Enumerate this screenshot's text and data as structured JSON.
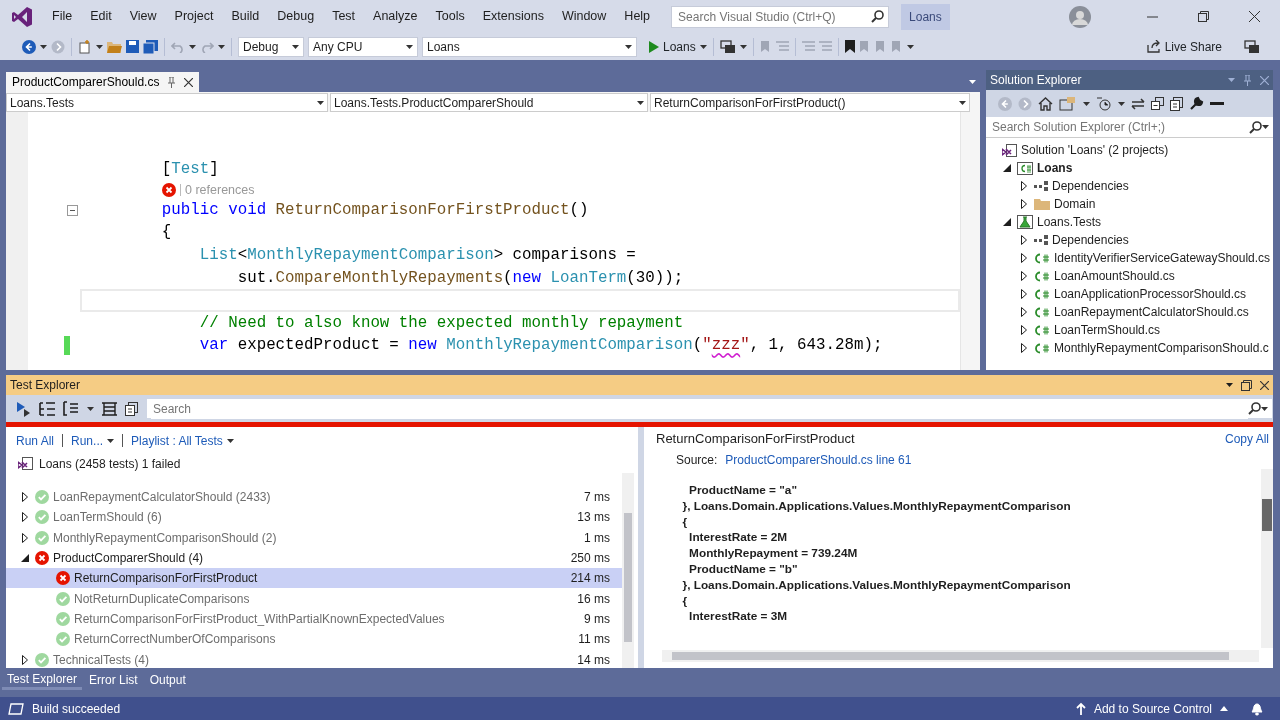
{
  "menu": [
    "File",
    "Edit",
    "View",
    "Project",
    "Build",
    "Debug",
    "Test",
    "Analyze",
    "Tools",
    "Extensions",
    "Window",
    "Help"
  ],
  "search": {
    "placeholder": "Search Visual Studio (Ctrl+Q)"
  },
  "solution_name": "Loans",
  "toolbar": {
    "configuration": "Debug",
    "platform": "Any CPU",
    "startup_project": "Loans",
    "run": "Loans",
    "live_share": "Live Share"
  },
  "editor": {
    "tab": "ProductComparerShould.cs",
    "navigation": [
      "Loans.Tests",
      "Loans.Tests.ProductComparerShould",
      "ReturnComparisonForFirstProduct()"
    ],
    "lines": [
      {
        "kind": "blank"
      },
      {
        "kind": "blank"
      },
      {
        "kind": "code",
        "tokens": [
          {
            "text": "        [",
            "kind": "plain"
          },
          {
            "text": "Test",
            "kind": "type"
          },
          {
            "text": "]",
            "kind": "plain"
          }
        ]
      },
      {
        "kind": "codelens",
        "failed": true,
        "text": "0 references"
      },
      {
        "kind": "code",
        "collapsible": true,
        "tokens": [
          {
            "text": "        public void ",
            "kind": "keyword"
          },
          {
            "text": "ReturnComparisonForFirstProduct",
            "kind": "method"
          },
          {
            "text": "()",
            "kind": "plain"
          }
        ]
      },
      {
        "kind": "code",
        "tokens": [
          {
            "text": "        {",
            "kind": "plain"
          }
        ]
      },
      {
        "kind": "code",
        "tokens": [
          {
            "text": "            List",
            "kind": "type"
          },
          {
            "text": "<",
            "kind": "plain"
          },
          {
            "text": "MonthlyRepaymentComparison",
            "kind": "type"
          },
          {
            "text": "> comparisons =",
            "kind": "plain"
          }
        ]
      },
      {
        "kind": "code",
        "tokens": [
          {
            "text": "                sut.",
            "kind": "plain"
          },
          {
            "text": "CompareMonthlyRepayments",
            "kind": "method"
          },
          {
            "text": "(",
            "kind": "plain"
          },
          {
            "text": "new ",
            "kind": "keyword"
          },
          {
            "text": "LoanTerm",
            "kind": "type"
          },
          {
            "text": "(30));",
            "kind": "plain"
          }
        ]
      },
      {
        "kind": "blank",
        "current": true
      },
      {
        "kind": "code",
        "tokens": [
          {
            "text": "            // Need to also know the expected monthly repayment",
            "kind": "comment"
          }
        ]
      },
      {
        "kind": "code",
        "changed": true,
        "tokens": [
          {
            "text": "            var ",
            "kind": "keyword"
          },
          {
            "text": "expectedProduct = ",
            "kind": "plain"
          },
          {
            "text": "new ",
            "kind": "keyword"
          },
          {
            "text": "MonthlyRepaymentComparison",
            "kind": "type"
          },
          {
            "text": "(",
            "kind": "plain"
          },
          {
            "text": "\"",
            "kind": "string"
          },
          {
            "text": "zzz",
            "kind": "string",
            "squiggle": true
          },
          {
            "text": "\"",
            "kind": "string"
          },
          {
            "text": ", 1, 643.28m);",
            "kind": "plain"
          }
        ]
      }
    ]
  },
  "solution_explorer": {
    "title": "Solution Explorer",
    "search": {
      "placeholder": "Search Solution Explorer (Ctrl+;)"
    },
    "tree": [
      {
        "label": "Solution 'Loans' (2 projects)",
        "kind": "solution",
        "children": [
          {
            "label": "Loans",
            "kind": "project",
            "expanded": true,
            "children": [
              {
                "label": "Dependencies",
                "kind": "dependencies",
                "expanded": false
              },
              {
                "label": "Domain",
                "kind": "folder",
                "expanded": false
              }
            ]
          },
          {
            "label": "Loans.Tests",
            "kind": "test-project",
            "expanded": true,
            "children": [
              {
                "label": "Dependencies",
                "kind": "dependencies",
                "expanded": false
              },
              {
                "label": "IdentityVerifierServiceGatewayShould.cs",
                "kind": "csharp",
                "expanded": false
              },
              {
                "label": "LoanAmountShould.cs",
                "kind": "csharp",
                "expanded": false
              },
              {
                "label": "LoanApplicationProcessorShould.cs",
                "kind": "csharp",
                "expanded": false
              },
              {
                "label": "LoanRepaymentCalculatorShould.cs",
                "kind": "csharp",
                "expanded": false
              },
              {
                "label": "LoanTermShould.cs",
                "kind": "csharp",
                "expanded": false
              },
              {
                "label": "MonthlyRepaymentComparisonShould.c",
                "kind": "csharp",
                "expanded": false
              }
            ]
          }
        ]
      }
    ]
  },
  "test_explorer": {
    "title": "Test Explorer",
    "search": {
      "placeholder": "Search"
    },
    "run_failed": true,
    "actions": [
      {
        "label": "Run All",
        "dropdown": false
      },
      {
        "label": "Run...",
        "dropdown": true
      },
      {
        "label": "Playlist : All Tests",
        "dropdown": true
      }
    ],
    "summary": "Loans (2458 tests) 1 failed",
    "tests": [
      {
        "name": "LoanRepaymentCalculatorShould (2433)",
        "duration": "7 ms",
        "failed": false,
        "expanded": false,
        "selected": false
      },
      {
        "name": "LoanTermShould (6)",
        "duration": "13 ms",
        "failed": false,
        "expanded": false,
        "selected": false
      },
      {
        "name": "MonthlyRepaymentComparisonShould (2)",
        "duration": "1 ms",
        "failed": false,
        "expanded": false,
        "selected": false
      },
      {
        "name": "ProductComparerShould (4)",
        "duration": "250 ms",
        "failed": true,
        "expanded": true,
        "selected": false,
        "children": [
          {
            "name": "ReturnComparisonForFirstProduct",
            "duration": "214 ms",
            "failed": true,
            "selected": true
          },
          {
            "name": "NotReturnDuplicateComparisons",
            "duration": "16 ms",
            "failed": false,
            "selected": false
          },
          {
            "name": "ReturnComparisonForFirstProduct_WithPartialKnownExpectedValues",
            "duration": "9 ms",
            "failed": false,
            "selected": false
          },
          {
            "name": "ReturnCorrectNumberOfComparisons",
            "duration": "11 ms",
            "failed": false,
            "selected": false
          }
        ]
      },
      {
        "name": "TechnicalTests (4)",
        "duration": "14 ms",
        "failed": false,
        "expanded": false,
        "selected": false
      }
    ],
    "detail": {
      "title": "ReturnComparisonForFirstProduct",
      "copy": "Copy All",
      "source_label": "Source:",
      "source_link": "ProductComparerShould.cs line 61",
      "output": [
        "    ProductName = \"a\"",
        "  }, Loans.Domain.Applications.Values.MonthlyRepaymentComparison",
        "  {",
        "    InterestRate = 2M",
        "    MonthlyRepayment = 739.24M",
        "    ProductName = \"b\"",
        "  }, Loans.Domain.Applications.Values.MonthlyRepaymentComparison",
        "  {",
        "    InterestRate = 3M"
      ]
    }
  },
  "bottom_tabs": [
    {
      "label": "Test Explorer",
      "selected": true
    },
    {
      "label": "Error List",
      "selected": false
    },
    {
      "label": "Output",
      "selected": false
    }
  ],
  "status_bar": {
    "message": "Build succeeded",
    "source_control": "Add to Source Control"
  }
}
